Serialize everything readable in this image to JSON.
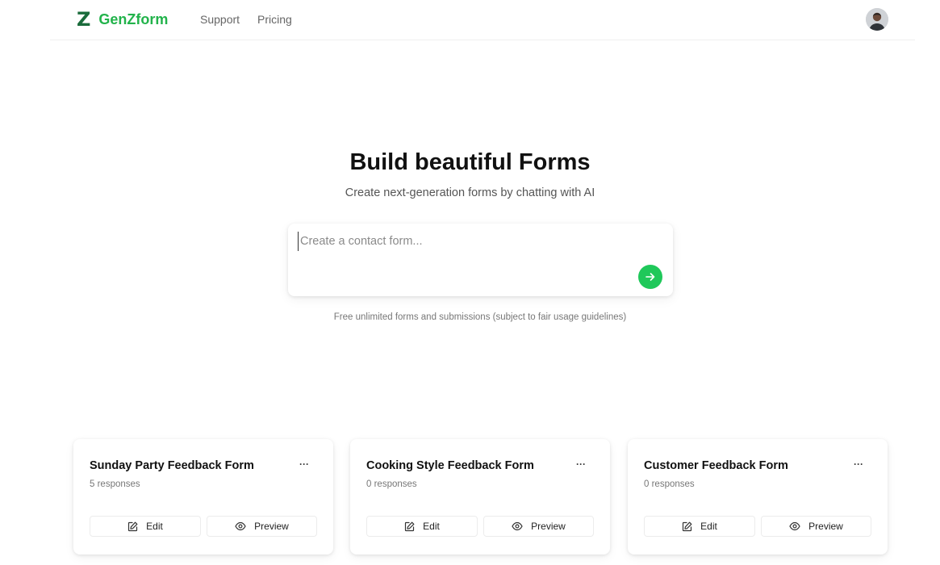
{
  "nav": {
    "logo_mark": "Z",
    "logo_text": "GenZform",
    "links": [
      {
        "label": "Support"
      },
      {
        "label": "Pricing"
      }
    ]
  },
  "hero": {
    "title": "Build beautiful Forms",
    "subtitle": "Create next-generation forms by chatting with AI"
  },
  "prompt": {
    "placeholder": "Create a contact form...",
    "value": ""
  },
  "disclaimer": "Free unlimited forms and submissions (subject to fair usage guidelines)",
  "forms": [
    {
      "title": "Sunday Party Feedback Form",
      "responses": "5 responses",
      "menu": "···",
      "edit_label": "Edit",
      "preview_label": "Preview"
    },
    {
      "title": "Cooking Style Feedback Form",
      "responses": "0 responses",
      "menu": "···",
      "edit_label": "Edit",
      "preview_label": "Preview"
    },
    {
      "title": "Customer Feedback Form",
      "responses": "0 responses",
      "menu": "···",
      "edit_label": "Edit",
      "preview_label": "Preview"
    }
  ],
  "icons": {
    "send": "arrow-right-icon",
    "edit": "edit-icon",
    "preview": "eye-icon",
    "menu": "more-horizontal-icon"
  },
  "colors": {
    "brand_green": "#22b34b",
    "logo_dark_green": "#1a6b3b",
    "send_button": "#1fc85a"
  }
}
